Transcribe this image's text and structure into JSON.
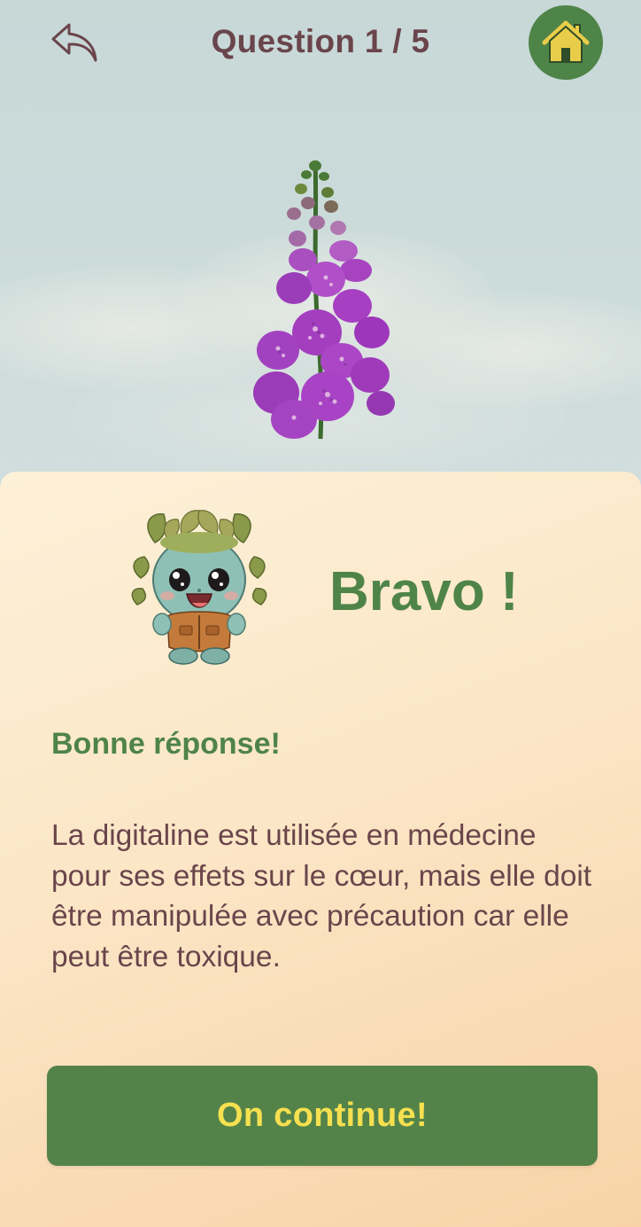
{
  "header": {
    "title": "Question 1 / 5",
    "back_icon": "back-arrow-icon",
    "home_icon": "home-icon"
  },
  "question": {
    "image": "foxglove-flower-illustration"
  },
  "feedback": {
    "mascot": "leafy-creature-mascot",
    "headline": "Bravo !",
    "subtitle": "Bonne réponse!",
    "explanation": "La digitaline est utilisée en médecine pour ses effets sur le cœur, mais elle doit être manipulée avec précaution car elle peut être toxique."
  },
  "actions": {
    "continue_label": "On continue!"
  },
  "colors": {
    "primary_green": "#54834a",
    "title_text": "#6a454b",
    "button_text": "#f6e04f",
    "home_icon_fill": "#e9cd4a"
  }
}
